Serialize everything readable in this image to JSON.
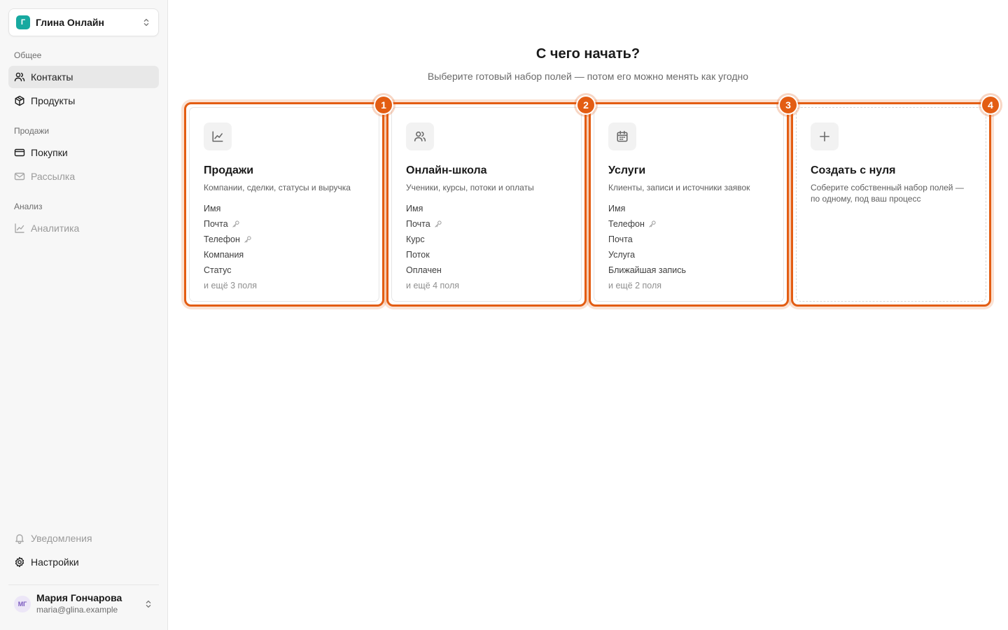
{
  "workspace": {
    "avatar_letter": "Г",
    "name": "Глина Онлайн",
    "accent": "#17a9a0"
  },
  "sidebar": {
    "section_general": "Общее",
    "contacts": "Контакты",
    "products": "Продукты",
    "section_sales": "Продажи",
    "purchases": "Покупки",
    "mailing": "Рассылка",
    "section_analysis": "Анализ",
    "analytics": "Аналитика",
    "notifications": "Уведомления",
    "settings": "Настройки"
  },
  "user": {
    "initials": "МГ",
    "name": "Мария Гончарова",
    "email": "maria@glina.example"
  },
  "main": {
    "title": "С чего начать?",
    "subtitle": "Выберите готовый набор полей — потом его можно менять как угодно"
  },
  "highlight_color": "#e35d13",
  "cards": [
    {
      "badge": "1",
      "icon": "chart-line-icon",
      "title": "Продажи",
      "desc": "Компании, сделки, статусы и выручка",
      "fields": [
        {
          "label": "Имя",
          "key": false
        },
        {
          "label": "Почта",
          "key": true
        },
        {
          "label": "Телефон",
          "key": true
        },
        {
          "label": "Компания",
          "key": false
        },
        {
          "label": "Статус",
          "key": false
        }
      ],
      "more": "и ещё 3 поля"
    },
    {
      "badge": "2",
      "icon": "users-icon",
      "title": "Онлайн-школа",
      "desc": "Ученики, курсы, потоки и оплаты",
      "fields": [
        {
          "label": "Имя",
          "key": false
        },
        {
          "label": "Почта",
          "key": true
        },
        {
          "label": "Курс",
          "key": false
        },
        {
          "label": "Поток",
          "key": false
        },
        {
          "label": "Оплачен",
          "key": false
        }
      ],
      "more": "и ещё 4 поля"
    },
    {
      "badge": "3",
      "icon": "calendar-icon",
      "title": "Услуги",
      "desc": "Клиенты, записи и источники заявок",
      "fields": [
        {
          "label": "Имя",
          "key": false
        },
        {
          "label": "Телефон",
          "key": true
        },
        {
          "label": "Почта",
          "key": false
        },
        {
          "label": "Услуга",
          "key": false
        },
        {
          "label": "Ближайшая запись",
          "key": false
        }
      ],
      "more": "и ещё 2 поля"
    },
    {
      "badge": "4",
      "icon": "plus-icon",
      "title": "Создать с нуля",
      "desc": "Соберите собственный набор полей — по одному, под ваш процесс",
      "fields": [],
      "more": ""
    }
  ]
}
